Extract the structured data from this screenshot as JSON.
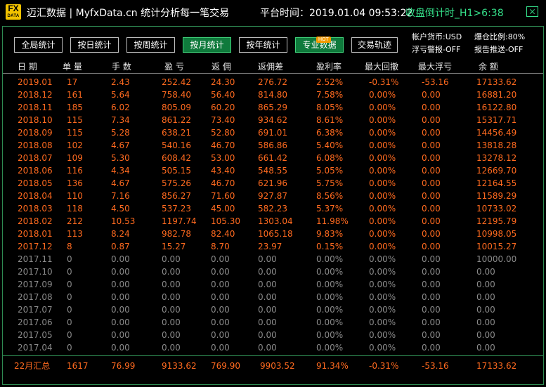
{
  "titlebar": {
    "logo_line1": "FX",
    "logo_line2": "DATA",
    "title": "迈汇数据 | MyfxData.cn  统计分析每一笔交易",
    "platform_time": "平台时间：2019.01.04 09:53:22",
    "countdown": "收盘倒计时_H1>6:38"
  },
  "tabs": [
    {
      "label": "全局统计",
      "active": false
    },
    {
      "label": "按日统计",
      "active": false
    },
    {
      "label": "按周统计",
      "active": false
    },
    {
      "label": "按月统计",
      "active": true
    },
    {
      "label": "按年统计",
      "active": false
    },
    {
      "label": "专业数据",
      "active": true
    },
    {
      "label": "交易轨迹",
      "active": false
    }
  ],
  "hot_badge": "HOT",
  "account": {
    "currency": "帐户货币:USD",
    "leverage": "爆仓比例:80%",
    "float_alert": "浮亏警报-OFF",
    "report_push": "报告推送-OFF"
  },
  "columns": [
    "日 期",
    "单 量",
    "手 数",
    "盈 亏",
    "返 佣",
    "返佣差",
    "盈利率",
    "最大回撤",
    "最大浮亏",
    "余 额"
  ],
  "rows": [
    [
      "2019.01",
      "17",
      "2.43",
      "252.42",
      "24.30",
      "276.72",
      "2.52%",
      "-0.31%",
      "-53.16",
      "17133.62"
    ],
    [
      "2018.12",
      "161",
      "5.64",
      "758.40",
      "56.40",
      "814.80",
      "7.58%",
      "0.00%",
      "0.00",
      "16881.20"
    ],
    [
      "2018.11",
      "185",
      "6.02",
      "805.09",
      "60.20",
      "865.29",
      "8.05%",
      "0.00%",
      "0.00",
      "16122.80"
    ],
    [
      "2018.10",
      "115",
      "7.34",
      "861.22",
      "73.40",
      "934.62",
      "8.61%",
      "0.00%",
      "0.00",
      "15317.71"
    ],
    [
      "2018.09",
      "115",
      "5.28",
      "638.21",
      "52.80",
      "691.01",
      "6.38%",
      "0.00%",
      "0.00",
      "14456.49"
    ],
    [
      "2018.08",
      "102",
      "4.67",
      "540.16",
      "46.70",
      "586.86",
      "5.40%",
      "0.00%",
      "0.00",
      "13818.28"
    ],
    [
      "2018.07",
      "109",
      "5.30",
      "608.42",
      "53.00",
      "661.42",
      "6.08%",
      "0.00%",
      "0.00",
      "13278.12"
    ],
    [
      "2018.06",
      "116",
      "4.34",
      "505.15",
      "43.40",
      "548.55",
      "5.05%",
      "0.00%",
      "0.00",
      "12669.70"
    ],
    [
      "2018.05",
      "136",
      "4.67",
      "575.26",
      "46.70",
      "621.96",
      "5.75%",
      "0.00%",
      "0.00",
      "12164.55"
    ],
    [
      "2018.04",
      "110",
      "7.16",
      "856.27",
      "71.60",
      "927.87",
      "8.56%",
      "0.00%",
      "0.00",
      "11589.29"
    ],
    [
      "2018.03",
      "118",
      "4.50",
      "537.23",
      "45.00",
      "582.23",
      "5.37%",
      "0.00%",
      "0.00",
      "10733.02"
    ],
    [
      "2018.02",
      "212",
      "10.53",
      "1197.74",
      "105.30",
      "1303.04",
      "11.98%",
      "0.00%",
      "0.00",
      "12195.79"
    ],
    [
      "2018.01",
      "113",
      "8.24",
      "982.78",
      "82.40",
      "1065.18",
      "9.83%",
      "0.00%",
      "0.00",
      "10998.05"
    ],
    [
      "2017.12",
      "8",
      "0.87",
      "15.27",
      "8.70",
      "23.97",
      "0.15%",
      "0.00%",
      "0.00",
      "10015.27"
    ],
    [
      "2017.11",
      "0",
      "0.00",
      "0.00",
      "0.00",
      "0.00",
      "0.00%",
      "0.00%",
      "0.00",
      "10000.00"
    ],
    [
      "2017.10",
      "0",
      "0.00",
      "0.00",
      "0.00",
      "0.00",
      "0.00%",
      "0.00%",
      "0.00",
      "0.00"
    ],
    [
      "2017.09",
      "0",
      "0.00",
      "0.00",
      "0.00",
      "0.00",
      "0.00%",
      "0.00%",
      "0.00",
      "0.00"
    ],
    [
      "2017.08",
      "0",
      "0.00",
      "0.00",
      "0.00",
      "0.00",
      "0.00%",
      "0.00%",
      "0.00",
      "0.00"
    ],
    [
      "2017.07",
      "0",
      "0.00",
      "0.00",
      "0.00",
      "0.00",
      "0.00%",
      "0.00%",
      "0.00",
      "0.00"
    ],
    [
      "2017.06",
      "0",
      "0.00",
      "0.00",
      "0.00",
      "0.00",
      "0.00%",
      "0.00%",
      "0.00",
      "0.00"
    ],
    [
      "2017.05",
      "0",
      "0.00",
      "0.00",
      "0.00",
      "0.00",
      "0.00%",
      "0.00%",
      "0.00",
      "0.00"
    ],
    [
      "2017.04",
      "0",
      "0.00",
      "0.00",
      "0.00",
      "0.00",
      "0.00%",
      "0.00%",
      "0.00",
      "0.00"
    ]
  ],
  "active_row_count": 14,
  "summary": [
    "22月汇总",
    "1617",
    "76.99",
    "9133.62",
    "769.90",
    "9903.52",
    "91.34%",
    "-0.31%",
    "-53.16",
    "17133.62"
  ],
  "colors": {
    "accent_green": "#35e08a",
    "active_value": "#ff6a1f",
    "inactive_value": "#8a8a8a",
    "tab_active_bg": "#0f7a3c"
  }
}
